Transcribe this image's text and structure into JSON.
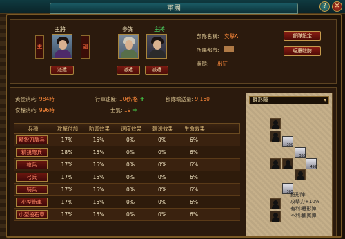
{
  "window": {
    "title": "軍團"
  },
  "top_buttons": {
    "help": "?",
    "close": "✕"
  },
  "generals": {
    "commander_header": "主將",
    "commander_tag": "主",
    "vice_tag": "副",
    "staff_header": "參謀",
    "staff_highlight": "主將",
    "dispatch_label": "派遣"
  },
  "info": {
    "unit_label": "部隊名稱:",
    "unit_value": "突擊A",
    "city_label": "所屬都市:",
    "status_label": "狀態:",
    "status_value": "出征",
    "set_button": "部隊設定",
    "return_button": "返還駐防"
  },
  "stats": {
    "gold_label": "黃金消耗:",
    "gold_value": "984時",
    "food_label": "食糧消耗:",
    "food_value": "996時",
    "speed_label": "行軍速度:",
    "speed_value": "10秒/格",
    "morale_label": "士氣:",
    "morale_value": "19",
    "transport_label": "部隊輸送量:",
    "transport_value": "9,160",
    "plus": "+"
  },
  "table": {
    "headers": [
      "兵種",
      "攻擊付加",
      "防禦效果",
      "速度效果",
      "輸送效果",
      "生命效果"
    ],
    "rows": [
      [
        "精銳刀盾兵",
        "17%",
        "15%",
        "0%",
        "0%",
        "6%"
      ],
      [
        "精銳弩兵",
        "18%",
        "15%",
        "0%",
        "0%",
        "6%"
      ],
      [
        "槍兵",
        "17%",
        "15%",
        "0%",
        "0%",
        "6%"
      ],
      [
        "弓兵",
        "17%",
        "15%",
        "0%",
        "0%",
        "6%"
      ],
      [
        "騎兵",
        "17%",
        "15%",
        "0%",
        "0%",
        "6%"
      ],
      [
        "小型衝車",
        "17%",
        "15%",
        "0%",
        "0%",
        "6%"
      ],
      [
        "小型投石車",
        "17%",
        "15%",
        "0%",
        "0%",
        "6%"
      ]
    ]
  },
  "formation": {
    "selected": "錐形陣",
    "unit_counts": [
      "390",
      "355",
      "492",
      "305"
    ],
    "desc_title": "錐形陣:",
    "desc_lines": [
      "攻擊力+10%",
      "有利:雁形陣",
      "不利:鶴翼陣"
    ]
  }
}
